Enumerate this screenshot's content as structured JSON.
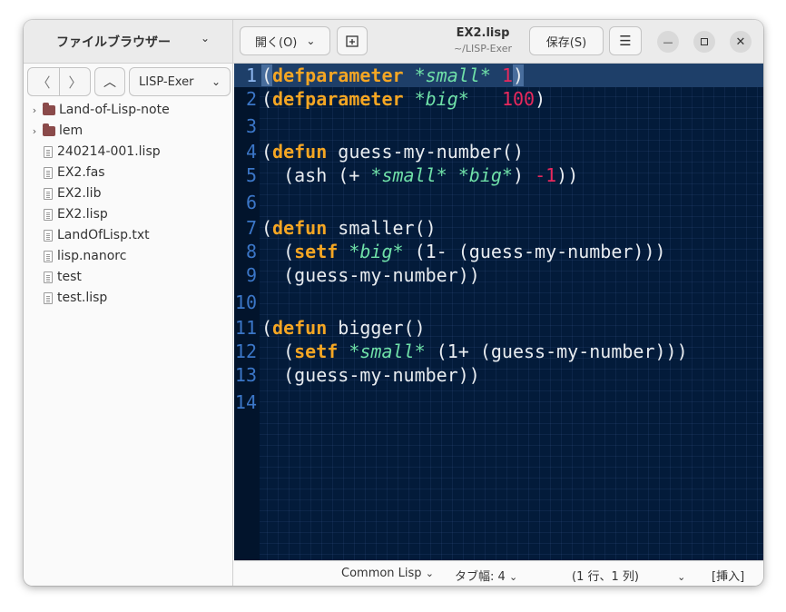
{
  "sidebar": {
    "title": "ファイルブラウザー",
    "location": "LISP-Exer",
    "items": [
      {
        "name": "Land-of-Lisp-note",
        "type": "folder"
      },
      {
        "name": "lem",
        "type": "folder"
      },
      {
        "name": "240214-001.lisp",
        "type": "file"
      },
      {
        "name": "EX2.fas",
        "type": "file"
      },
      {
        "name": "EX2.lib",
        "type": "file"
      },
      {
        "name": "EX2.lisp",
        "type": "file"
      },
      {
        "name": "LandOfLisp.txt",
        "type": "file"
      },
      {
        "name": "lisp.nanorc",
        "type": "file"
      },
      {
        "name": "test",
        "type": "file"
      },
      {
        "name": "test.lisp",
        "type": "file"
      }
    ]
  },
  "header": {
    "open_label": "開く(O)",
    "doc_title": "EX2.lisp",
    "doc_path": "~/LISP-Exer",
    "save_label": "保存(S)"
  },
  "editor": {
    "lines": [
      [
        [
          "(",
          "p"
        ],
        [
          "defparameter",
          "kw"
        ],
        [
          " ",
          "p"
        ],
        [
          "*small*",
          "var"
        ],
        [
          " ",
          "p"
        ],
        [
          "1",
          "num"
        ],
        [
          ")",
          "p"
        ]
      ],
      [
        [
          "(",
          "p"
        ],
        [
          "defparameter",
          "kw"
        ],
        [
          " ",
          "p"
        ],
        [
          "*big*",
          "var"
        ],
        [
          "   ",
          "p"
        ],
        [
          "100",
          "num"
        ],
        [
          ")",
          "p"
        ]
      ],
      [],
      [
        [
          "(",
          "p"
        ],
        [
          "defun",
          "kw"
        ],
        [
          " guess-my-number()",
          "p"
        ]
      ],
      [
        [
          "  (ash (+ ",
          "p"
        ],
        [
          "*small*",
          "var"
        ],
        [
          " ",
          "p"
        ],
        [
          "*big*",
          "var"
        ],
        [
          ") ",
          "p"
        ],
        [
          "-1",
          "num"
        ],
        [
          "))",
          "p"
        ]
      ],
      [],
      [
        [
          "(",
          "p"
        ],
        [
          "defun",
          "kw"
        ],
        [
          " smaller()",
          "p"
        ]
      ],
      [
        [
          "  (",
          "p"
        ],
        [
          "setf",
          "kw"
        ],
        [
          " ",
          "p"
        ],
        [
          "*big*",
          "var"
        ],
        [
          " (1- (guess-my-number)))",
          "p"
        ]
      ],
      [
        [
          "  (guess-my-number))",
          "p"
        ]
      ],
      [],
      [
        [
          "(",
          "p"
        ],
        [
          "defun",
          "kw"
        ],
        [
          " bigger()",
          "p"
        ]
      ],
      [
        [
          "  (",
          "p"
        ],
        [
          "setf",
          "kw"
        ],
        [
          " ",
          "p"
        ],
        [
          "*small*",
          "var"
        ],
        [
          " (1+ (guess-my-number)))",
          "p"
        ]
      ],
      [
        [
          "  (guess-my-number))",
          "p"
        ]
      ],
      []
    ]
  },
  "status": {
    "language": "Common Lisp",
    "tab_width": "タブ幅: 4",
    "position": "(1 行、1 列)",
    "mode": "[挿入]"
  },
  "colors": {
    "editor_bg": "#031b3a",
    "keyword": "#f5a623",
    "variable": "#6fe0a8",
    "number": "#e8285c",
    "line_number": "#3b76c7"
  }
}
